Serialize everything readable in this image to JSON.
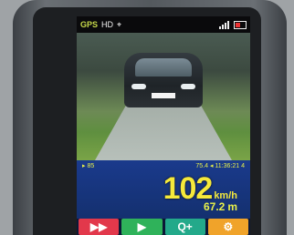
{
  "statusbar": {
    "operator": "GPS",
    "badge": "HD",
    "gps_glyph": "⌖",
    "time": "",
    "icons": [
      "gps-icon",
      "signal-icon",
      "battery-icon"
    ]
  },
  "camera": {
    "subject": "oncoming-car"
  },
  "info": {
    "left": "▸ 85",
    "middle": "75.4 ◂ 11:36:21 4",
    "right": ""
  },
  "measurement": {
    "speed": "102",
    "speed_unit": "km/h",
    "distance": "67.2",
    "distance_unit": "m"
  },
  "buttons": [
    {
      "glyph": "▶▶",
      "icon": "fast-forward-icon",
      "color": "#e2384b"
    },
    {
      "glyph": "▶",
      "icon": "play-icon",
      "color": "#2fb25a"
    },
    {
      "glyph": "Q+",
      "icon": "zoom-in-icon",
      "color": "#23a98a"
    },
    {
      "glyph": "⚙",
      "icon": "settings-icon",
      "color": "#f0a32a"
    }
  ]
}
